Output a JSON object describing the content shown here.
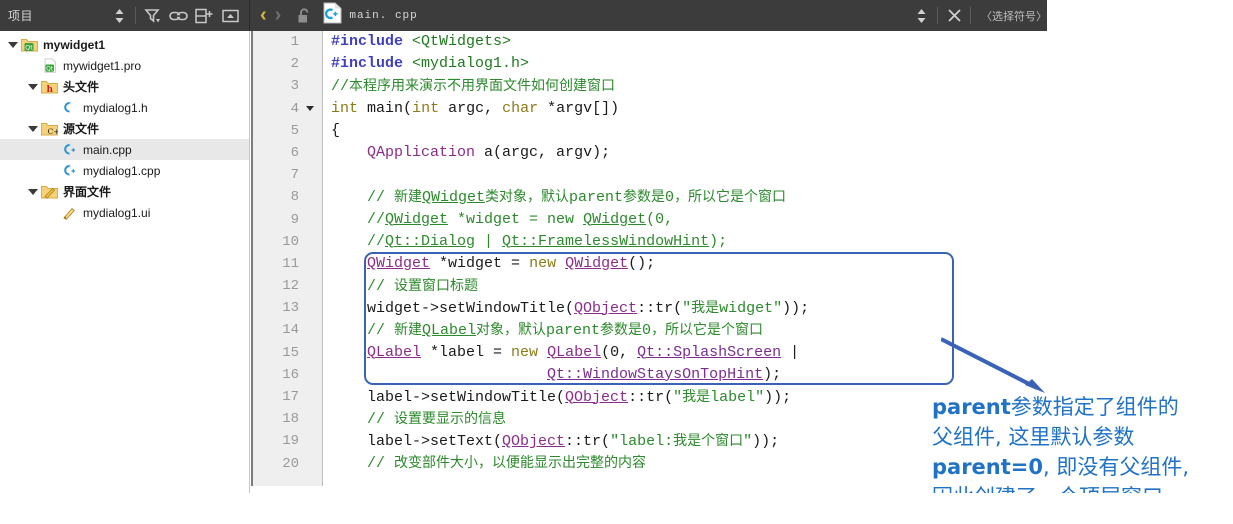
{
  "topbar": {
    "project_label": "项目",
    "icons": [
      {
        "name": "splitter-updown-icon",
        "glyph": "⬍"
      },
      {
        "name": "filter-icon",
        "glyph": "filter"
      },
      {
        "name": "link-icon",
        "glyph": "link"
      },
      {
        "name": "split-add-icon",
        "glyph": "split"
      },
      {
        "name": "collapse-panel-icon",
        "glyph": "panel"
      }
    ],
    "nav_back": "‹",
    "nav_forward": "›",
    "lock_icon": "unlocked-padlock-icon",
    "file_icon_label": "C+",
    "file_name": "main. cpp",
    "updown_icon": "⬍",
    "close_icon": "✕",
    "symbol_selector": "〈选择符号〉"
  },
  "sidebar": {
    "items": [
      {
        "label": "mywidget1",
        "indent": 0,
        "expanded": true,
        "icon": "qt-project-folder-icon",
        "bold": true,
        "selected": false
      },
      {
        "label": "mywidget1.pro",
        "indent": 1,
        "expanded": null,
        "icon": "qt-pro-file-icon",
        "bold": false,
        "selected": false
      },
      {
        "label": "头文件",
        "indent": 1,
        "expanded": true,
        "icon": "header-folder-icon",
        "bold": true,
        "selected": false
      },
      {
        "label": "mydialog1.h",
        "indent": 2,
        "expanded": null,
        "icon": "c-header-file-icon",
        "bold": false,
        "selected": false
      },
      {
        "label": "源文件",
        "indent": 1,
        "expanded": true,
        "icon": "source-folder-icon",
        "bold": true,
        "selected": false
      },
      {
        "label": "main.cpp",
        "indent": 2,
        "expanded": null,
        "icon": "cpp-source-file-icon",
        "bold": false,
        "selected": true
      },
      {
        "label": "mydialog1.cpp",
        "indent": 2,
        "expanded": null,
        "icon": "cpp-source-file-icon",
        "bold": false,
        "selected": false
      },
      {
        "label": "界面文件",
        "indent": 1,
        "expanded": true,
        "icon": "ui-folder-icon",
        "bold": true,
        "selected": false
      },
      {
        "label": "mydialog1.ui",
        "indent": 2,
        "expanded": null,
        "icon": "ui-file-icon",
        "bold": false,
        "selected": false
      }
    ]
  },
  "editor": {
    "lines": [
      {
        "n": "1",
        "fold": false,
        "tokens": [
          {
            "c": "t-pre",
            "t": "#include"
          },
          {
            "c": "t-plain",
            "t": " "
          },
          {
            "c": "t-inc",
            "t": "<QtWidgets>"
          }
        ]
      },
      {
        "n": "2",
        "fold": false,
        "tokens": [
          {
            "c": "t-pre",
            "t": "#include"
          },
          {
            "c": "t-plain",
            "t": " "
          },
          {
            "c": "t-inc",
            "t": "<mydialog1.h>"
          }
        ]
      },
      {
        "n": "3",
        "fold": false,
        "tokens": [
          {
            "c": "t-cmt",
            "t": "//"
          },
          {
            "c": "t-cmt cjk",
            "t": "本程序用来演示不用界面文件如何创建窗口"
          }
        ]
      },
      {
        "n": "4",
        "fold": true,
        "tokens": [
          {
            "c": "t-kw",
            "t": "int"
          },
          {
            "c": "t-plain",
            "t": " "
          },
          {
            "c": "t-plain",
            "t": "main"
          },
          {
            "c": "t-plain",
            "t": "("
          },
          {
            "c": "t-kw",
            "t": "int"
          },
          {
            "c": "t-plain",
            "t": " argc, "
          },
          {
            "c": "t-kw",
            "t": "char"
          },
          {
            "c": "t-plain",
            "t": " *argv[])"
          }
        ]
      },
      {
        "n": "5",
        "fold": false,
        "tokens": [
          {
            "c": "t-plain",
            "t": "{"
          }
        ]
      },
      {
        "n": "6",
        "fold": false,
        "tokens": [
          {
            "c": "t-plain",
            "t": "    "
          },
          {
            "c": "t-type",
            "t": "QApplication"
          },
          {
            "c": "t-plain",
            "t": " a(argc, argv);"
          }
        ]
      },
      {
        "n": "7",
        "fold": false,
        "tokens": []
      },
      {
        "n": "8",
        "fold": false,
        "tokens": [
          {
            "c": "t-cmt",
            "t": "    // "
          },
          {
            "c": "t-cmt cjk",
            "t": "新建"
          },
          {
            "c": "t-cmtu",
            "t": "QWidget"
          },
          {
            "c": "t-cmt cjk",
            "t": "类对象，默认"
          },
          {
            "c": "t-cmt",
            "t": "parent"
          },
          {
            "c": "t-cmt cjk",
            "t": "参数是"
          },
          {
            "c": "t-cmt",
            "t": "0"
          },
          {
            "c": "t-cmt cjk",
            "t": "，所以它是个窗口"
          }
        ]
      },
      {
        "n": "9",
        "fold": false,
        "tokens": [
          {
            "c": "t-cmt",
            "t": "    //"
          },
          {
            "c": "t-cmtu",
            "t": "QWidget"
          },
          {
            "c": "t-cmt",
            "t": " *widget = new "
          },
          {
            "c": "t-cmtu",
            "t": "QWidget"
          },
          {
            "c": "t-cmt",
            "t": "(0,"
          }
        ]
      },
      {
        "n": "10",
        "fold": false,
        "tokens": [
          {
            "c": "t-cmt",
            "t": "    //"
          },
          {
            "c": "t-cmtu",
            "t": "Qt::Dialog"
          },
          {
            "c": "t-cmt",
            "t": " | "
          },
          {
            "c": "t-cmtu",
            "t": "Qt::FramelessWindowHint"
          },
          {
            "c": "t-cmt",
            "t": ");"
          }
        ]
      },
      {
        "n": "11",
        "fold": false,
        "tokens": [
          {
            "c": "t-plain",
            "t": "    "
          },
          {
            "c": "t-typu",
            "t": "QWidget"
          },
          {
            "c": "t-plain",
            "t": " *widget = "
          },
          {
            "c": "t-kw",
            "t": "new"
          },
          {
            "c": "t-plain",
            "t": " "
          },
          {
            "c": "t-typu",
            "t": "QWidget"
          },
          {
            "c": "t-plain",
            "t": "();"
          }
        ]
      },
      {
        "n": "12",
        "fold": false,
        "tokens": [
          {
            "c": "t-cmt",
            "t": "    // "
          },
          {
            "c": "t-cmt cjk",
            "t": "设置窗口标题"
          }
        ]
      },
      {
        "n": "13",
        "fold": false,
        "tokens": [
          {
            "c": "t-plain",
            "t": "    widget->setWindowTitle("
          },
          {
            "c": "t-typu",
            "t": "QObject"
          },
          {
            "c": "t-plain",
            "t": "::tr("
          },
          {
            "c": "t-str",
            "t": "\""
          },
          {
            "c": "t-str cjk",
            "t": "我是"
          },
          {
            "c": "t-str",
            "t": "widget\""
          },
          {
            "c": "t-plain",
            "t": "));"
          }
        ]
      },
      {
        "n": "14",
        "fold": false,
        "tokens": [
          {
            "c": "t-cmt",
            "t": "    // "
          },
          {
            "c": "t-cmt cjk",
            "t": "新建"
          },
          {
            "c": "t-cmtu",
            "t": "QLabel"
          },
          {
            "c": "t-cmt cjk",
            "t": "对象，默认"
          },
          {
            "c": "t-cmt",
            "t": "parent"
          },
          {
            "c": "t-cmt cjk",
            "t": "参数是"
          },
          {
            "c": "t-cmt",
            "t": "0"
          },
          {
            "c": "t-cmt cjk",
            "t": "，所以它是个窗口"
          }
        ]
      },
      {
        "n": "15",
        "fold": false,
        "tokens": [
          {
            "c": "t-plain",
            "t": "    "
          },
          {
            "c": "t-typu",
            "t": "QLabel"
          },
          {
            "c": "t-plain",
            "t": " *label = "
          },
          {
            "c": "t-kw",
            "t": "new"
          },
          {
            "c": "t-plain",
            "t": " "
          },
          {
            "c": "t-typu",
            "t": "QLabel"
          },
          {
            "c": "t-plain",
            "t": "(0, "
          },
          {
            "c": "t-cls",
            "t": "Qt::SplashScreen"
          },
          {
            "c": "t-plain",
            "t": " |"
          }
        ]
      },
      {
        "n": "16",
        "fold": false,
        "tokens": [
          {
            "c": "t-plain",
            "t": "                        "
          },
          {
            "c": "t-cls",
            "t": "Qt::WindowStaysOnTopHint"
          },
          {
            "c": "t-plain",
            "t": ");"
          }
        ]
      },
      {
        "n": "17",
        "fold": false,
        "tokens": [
          {
            "c": "t-plain",
            "t": "    label->setWindowTitle("
          },
          {
            "c": "t-typu",
            "t": "QObject"
          },
          {
            "c": "t-plain",
            "t": "::tr("
          },
          {
            "c": "t-str",
            "t": "\""
          },
          {
            "c": "t-str cjk",
            "t": "我是"
          },
          {
            "c": "t-str",
            "t": "label\""
          },
          {
            "c": "t-plain",
            "t": "));"
          }
        ]
      },
      {
        "n": "18",
        "fold": false,
        "tokens": [
          {
            "c": "t-cmt",
            "t": "    // "
          },
          {
            "c": "t-cmt cjk",
            "t": "设置要显示的信息"
          }
        ]
      },
      {
        "n": "19",
        "fold": false,
        "tokens": [
          {
            "c": "t-plain",
            "t": "    label->setText("
          },
          {
            "c": "t-typu",
            "t": "QObject"
          },
          {
            "c": "t-plain",
            "t": "::tr("
          },
          {
            "c": "t-str",
            "t": "\"label:"
          },
          {
            "c": "t-str cjk",
            "t": "我是个窗口"
          },
          {
            "c": "t-str",
            "t": "\""
          },
          {
            "c": "t-plain",
            "t": "));"
          }
        ]
      },
      {
        "n": "20",
        "fold": false,
        "tokens": [
          {
            "c": "t-cmt",
            "t": "    // "
          },
          {
            "c": "t-cmt cjk",
            "t": "改变部件大小，以便能显示出完整的内容"
          }
        ]
      }
    ]
  },
  "annotation": {
    "highlight_box_color": "#3b63b5",
    "text_color": "#1f72c4",
    "lines": [
      [
        {
          "k": "lat",
          "t": "parent"
        },
        {
          "k": "cjk",
          "t": "参数指定了组件的"
        }
      ],
      [
        {
          "k": "cjk",
          "t": "父组件, 这里默认参数"
        }
      ],
      [
        {
          "k": "lat",
          "t": "parent=0"
        },
        {
          "k": "cjk",
          "t": ", 即没有父组件,"
        }
      ],
      [
        {
          "k": "cjk",
          "t": "因此创建了一个顶层窗口"
        }
      ]
    ]
  }
}
